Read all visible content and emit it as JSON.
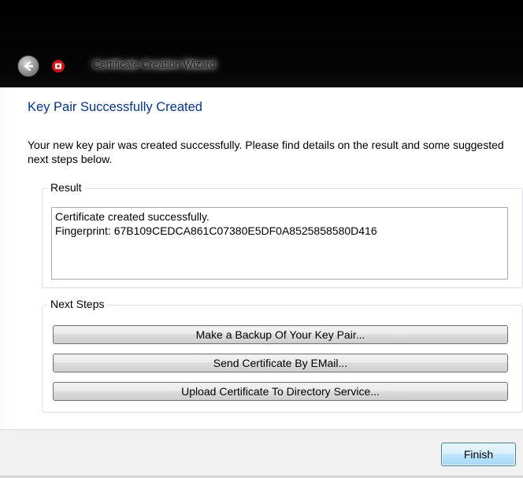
{
  "window": {
    "title": "Certificate Creation Wizard",
    "back_icon": "back-arrow-icon",
    "app_icon": "certificate-app-icon"
  },
  "page": {
    "heading": "Key Pair Successfully Created",
    "description": "Your new key pair was created successfully. Please find details on the result and some suggested next steps below."
  },
  "result": {
    "legend": "Result",
    "lines": [
      "Certificate created successfully.",
      "Fingerprint: 67B109CEDCA861C07380E5DF0A8525858580D416"
    ]
  },
  "next_steps": {
    "legend": "Next Steps",
    "buttons": [
      "Make a Backup Of Your Key Pair...",
      "Send Certificate By EMail...",
      "Upload Certificate To Directory Service..."
    ]
  },
  "footer": {
    "finish_label": "Finish"
  },
  "colors": {
    "heading": "#003399",
    "titlebar": "#000000",
    "footer": "#f0f0f0",
    "default_button_border": "#3c7fb1"
  }
}
